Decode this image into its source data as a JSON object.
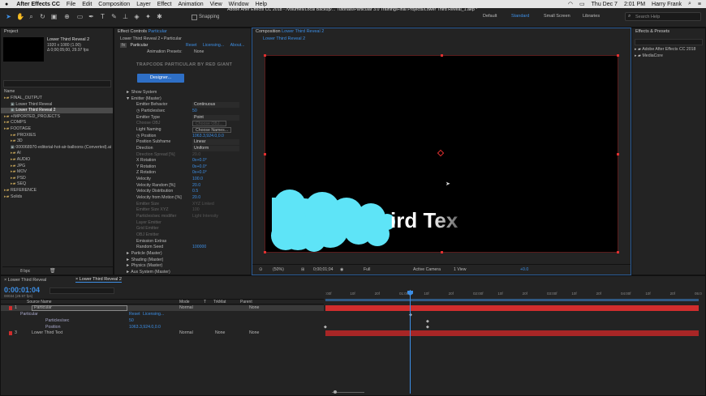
{
  "menubar": {
    "app": "After Effects CC",
    "items": [
      "File",
      "Edit",
      "Composition",
      "Layer",
      "Effect",
      "Animation",
      "View",
      "Window",
      "Help"
    ],
    "date": "Thu Dec 7",
    "time": "2:01 PM",
    "user": "Harry Frank"
  },
  "toolbar": {
    "snapping": "Snapping",
    "path": "Adobe After Effects CC 2018 - /Volumes/Local Backup/... Tutorials/Particular 3.0 Training/Final Projects/Lower Third Reveal_1.aep *",
    "workspaces": [
      "Default",
      "Standard",
      "Small Screen",
      "Libraries"
    ],
    "search": "Search Help"
  },
  "project": {
    "title": "Project",
    "item_name": "Lower Third Reveal 2",
    "item_dims": "1920 x 1080 (1.00)",
    "item_dur": "Δ 0;00;05;00, 29.97 fps",
    "col_name": "Name",
    "items": [
      {
        "label": "FINAL_OUTPUT",
        "indent": 0,
        "type": "folder"
      },
      {
        "label": "Lower Third Reveal",
        "indent": 1,
        "type": "comp"
      },
      {
        "label": "Lower Third Reveal 2",
        "indent": 1,
        "type": "comp",
        "selected": true
      },
      {
        "label": "+IMPORTED_PROJECTS",
        "indent": 0,
        "type": "folder"
      },
      {
        "label": "COMPS",
        "indent": 0,
        "type": "folder"
      },
      {
        "label": "FOOTAGE",
        "indent": 0,
        "type": "folder"
      },
      {
        "label": "PROXIES",
        "indent": 1,
        "type": "folder"
      },
      {
        "label": "3D",
        "indent": 1,
        "type": "folder"
      },
      {
        "label": "000068970-editorial-hot-air-balloons (Converted).ai",
        "indent": 1,
        "type": "file"
      },
      {
        "label": "AI",
        "indent": 1,
        "type": "folder"
      },
      {
        "label": "AUDIO",
        "indent": 1,
        "type": "folder"
      },
      {
        "label": "JPG",
        "indent": 1,
        "type": "folder"
      },
      {
        "label": "MOV",
        "indent": 1,
        "type": "folder"
      },
      {
        "label": "PSD",
        "indent": 1,
        "type": "folder"
      },
      {
        "label": "SEQ",
        "indent": 1,
        "type": "folder"
      },
      {
        "label": "REFERENCE",
        "indent": 0,
        "type": "folder"
      },
      {
        "label": "Solids",
        "indent": 0,
        "type": "folder"
      }
    ],
    "bpc": "8 bpc"
  },
  "effects": {
    "tab": "Effect Controls",
    "tab_layer": "Particular",
    "comp_label": "Lower Third Reveal 2 • Particular",
    "fx": "fx",
    "fx_name": "Particular",
    "reset": "Reset",
    "licensing": "Licensing...",
    "about": "About...",
    "presets_label": "Animation Presets:",
    "presets_val": "None",
    "logo": "TRAPCODE PARTICULAR BY RED GIANT",
    "designer": "Designer...",
    "rows": [
      {
        "l": "Show System",
        "v": "",
        "lvl": 0,
        "tw": "►"
      },
      {
        "l": "Emitter (Master)",
        "v": "",
        "lvl": 0,
        "tw": "▼"
      },
      {
        "l": "Emitter Behavior",
        "v": "Continuous",
        "lvl": 1,
        "dd": true
      },
      {
        "l": "Particles/sec",
        "v": "50",
        "lvl": 1,
        "sw": true
      },
      {
        "l": "Emitter Type",
        "v": "Point",
        "lvl": 1,
        "dd": true
      },
      {
        "l": "Choose OBJ",
        "v": "",
        "lvl": 1,
        "dim": true,
        "btn": "Choose OBJ..."
      },
      {
        "l": "Light Naming",
        "v": "",
        "lvl": 1,
        "btn": "Choose Names..."
      },
      {
        "l": "Position",
        "v": "1063.3,924.0,0.0",
        "lvl": 1,
        "sw": true
      },
      {
        "l": "Position Subframe",
        "v": "Linear",
        "lvl": 1,
        "dd": true
      },
      {
        "l": "Direction",
        "v": "Uniform",
        "lvl": 1,
        "dd": true
      },
      {
        "l": "Direction Spread [%]",
        "v": "20.0",
        "lvl": 1,
        "dim": true
      },
      {
        "l": "X Rotation",
        "v": "0x+0.0°",
        "lvl": 1
      },
      {
        "l": "Y Rotation",
        "v": "0x+0.0°",
        "lvl": 1
      },
      {
        "l": "Z Rotation",
        "v": "0x+0.0°",
        "lvl": 1
      },
      {
        "l": "Velocity",
        "v": "100.0",
        "lvl": 1
      },
      {
        "l": "Velocity Random [%]",
        "v": "20.0",
        "lvl": 1
      },
      {
        "l": "Velocity Distribution",
        "v": "0.5",
        "lvl": 1
      },
      {
        "l": "Velocity from Motion [%]",
        "v": "20.0",
        "lvl": 1
      },
      {
        "l": "Emitter Size",
        "v": "XYZ Linked",
        "lvl": 1,
        "dim": true
      },
      {
        "l": "Emitter Size XYZ",
        "v": "100",
        "lvl": 1,
        "dim": true
      },
      {
        "l": "Particles/sec modifier",
        "v": "Light Intensity",
        "lvl": 1,
        "dim": true
      },
      {
        "l": "Layer Emitter",
        "v": "",
        "lvl": 1,
        "dim": true
      },
      {
        "l": "Grid Emitter",
        "v": "",
        "lvl": 1,
        "dim": true
      },
      {
        "l": "OBJ Emitter",
        "v": "",
        "lvl": 1,
        "dim": true
      },
      {
        "l": "Emission Extras",
        "v": "",
        "lvl": 1
      },
      {
        "l": "Random Seed",
        "v": "100000",
        "lvl": 1
      },
      {
        "l": "Particle (Master)",
        "v": "",
        "lvl": 0,
        "tw": "►"
      },
      {
        "l": "Shading (Master)",
        "v": "",
        "lvl": 0,
        "tw": "►"
      },
      {
        "l": "Physics (Master)",
        "v": "",
        "lvl": 0,
        "tw": "►"
      },
      {
        "l": "Aux System (Master)",
        "v": "",
        "lvl": 0,
        "tw": "►"
      }
    ]
  },
  "composition": {
    "tab": "Composition",
    "name": "Lower Third Reveal 2",
    "subtab": "Lower Third Reveal 2",
    "text": "ird Tex",
    "zoom": "(50%)",
    "timecode": "0;00;01;04",
    "resolution": "Full",
    "camera": "Active Camera",
    "view": "1 View",
    "exposure": "+0.0"
  },
  "effects_presets": {
    "title": "Effects & Presets",
    "search": "",
    "items": [
      "Adobe After Effects CC 2018",
      "MediaCore"
    ]
  },
  "timeline": {
    "tab_inactive": "Lower Third Reveal",
    "tab_active": "Lower Third Reveal 2",
    "timecode": "0:00:01:04",
    "frames": "00034 (29.97 fps)",
    "headers": [
      "Source Name",
      "Mode",
      "T",
      "TrkMat",
      "Parent"
    ],
    "ruler": [
      ":00f",
      "10f",
      "20f",
      "01:00f",
      "10f",
      "20f",
      "02:00f",
      "10f",
      "20f",
      "03:00f",
      "10f",
      "20f",
      "04:00f",
      "10f",
      "20f",
      "05:0"
    ],
    "layers": [
      {
        "num": "1",
        "name": "Particular",
        "mode": "Normal",
        "trk": "",
        "parent": "None",
        "selected": true
      },
      {
        "num": "",
        "name": "Particular",
        "mode": "",
        "trk": "",
        "parent": "",
        "sub": true,
        "reset": "Reset",
        "lic": "Licensing..."
      },
      {
        "num": "",
        "name": "Particles/sec",
        "value": "50",
        "prop": true
      },
      {
        "num": "",
        "name": "Position",
        "value": "1063.3,924.0,0.0",
        "prop": true
      },
      {
        "num": "3",
        "name": "Lower Third Text",
        "mode": "Normal",
        "trk": "None",
        "parent": "None"
      }
    ]
  },
  "colors": {
    "accent": "#3d8fe6",
    "red": "#d02d2d",
    "particle": "#5ee4f7"
  }
}
